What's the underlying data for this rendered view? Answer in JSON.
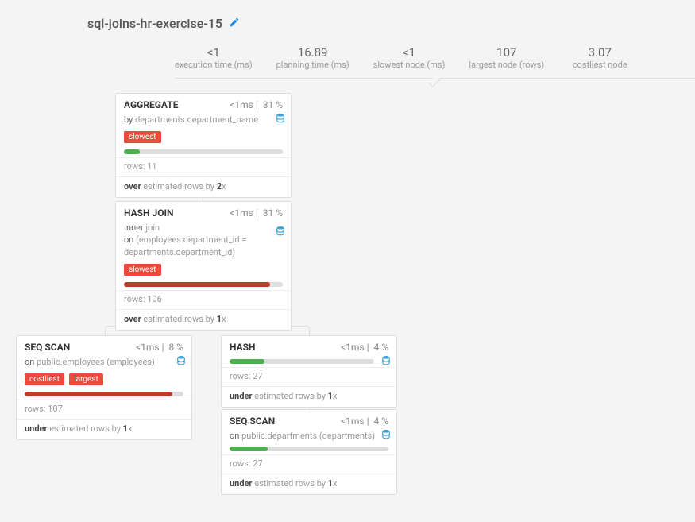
{
  "plan_title": "sql-joins-hr-exercise-15",
  "stats": {
    "exec_time": {
      "val": "<1",
      "lbl": "execution time (ms)"
    },
    "plan_time": {
      "val": "16.89",
      "lbl": "planning time (ms)"
    },
    "slowest": {
      "val": "<1",
      "lbl": "slowest node (ms)"
    },
    "largest": {
      "val": "107",
      "lbl": "largest node (rows)"
    },
    "costliest": {
      "val": "3.07",
      "lbl": "costliest node"
    }
  },
  "nodes": {
    "aggregate": {
      "name": "AGGREGATE",
      "time": "<1ms",
      "pct": "31 %",
      "sub_prefix": "by ",
      "sub_value": "departments.department_name",
      "tags": [
        "slowest"
      ],
      "bar_color": "green",
      "bar_pct": 10,
      "rows": "rows: 11",
      "est_prefix": "over",
      "est_mid": " estimated rows by ",
      "est_factor": "2",
      "est_suffix": "x"
    },
    "hashjoin": {
      "name": "HASH JOIN",
      "time": "<1ms",
      "pct": "31 %",
      "sub_kind_label": "Inner",
      "sub_kind_suffix": " join",
      "sub_on_label": "on ",
      "sub_on_value": "(employees.department_id = departments.department_id)",
      "tags": [
        "slowest"
      ],
      "bar_color": "red",
      "bar_pct": 92,
      "rows": "rows: 106",
      "est_prefix": "over",
      "est_mid": " estimated rows by ",
      "est_factor": "1",
      "est_suffix": "x"
    },
    "seqscan_emp": {
      "name": "SEQ SCAN",
      "time": "<1ms",
      "pct": "8 %",
      "sub_prefix": "on ",
      "sub_value": "public.employees (employees)",
      "tags": [
        "costliest",
        "largest"
      ],
      "bar_color": "red",
      "bar_pct": 93,
      "rows": "rows: 107",
      "est_prefix": "under",
      "est_mid": " estimated rows by ",
      "est_factor": "1",
      "est_suffix": "x"
    },
    "hash": {
      "name": "HASH",
      "time": "<1ms",
      "pct": "4 %",
      "bar_color": "green",
      "bar_pct": 24,
      "rows": "rows: 27",
      "est_prefix": "under",
      "est_mid": " estimated rows by ",
      "est_factor": "1",
      "est_suffix": "x"
    },
    "seqscan_dep": {
      "name": "SEQ SCAN",
      "time": "<1ms",
      "pct": "4 %",
      "sub_prefix": "on ",
      "sub_value": "public.departments (departments)",
      "bar_color": "green",
      "bar_pct": 24,
      "rows": "rows: 27",
      "est_prefix": "under",
      "est_mid": " estimated rows by ",
      "est_factor": "1",
      "est_suffix": "x"
    }
  }
}
